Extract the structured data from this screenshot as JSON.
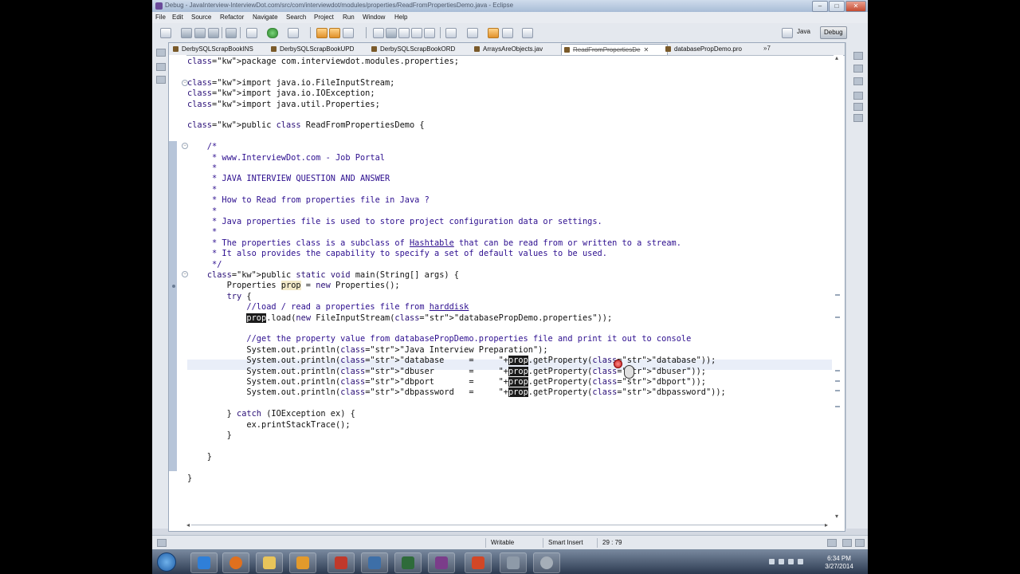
{
  "window": {
    "title": "Debug - JavaInterview-InterviewDot.com/src/com/interviewdot/modules/properties/ReadFromPropertiesDemo.java - Eclipse",
    "controls": {
      "minimize": "–",
      "maximize": "□",
      "close": "✕"
    }
  },
  "menu": [
    "File",
    "Edit",
    "Source",
    "Refactor",
    "Navigate",
    "Search",
    "Project",
    "Run",
    "Window",
    "Help"
  ],
  "perspectives": {
    "java": "Java",
    "debug": "Debug"
  },
  "toolbar_icons": [
    "new-icon",
    "save-icon",
    "save-all-icon",
    "print-icon",
    "debug-icon",
    "run-icon",
    "run-external-icon",
    "new-java-project-icon",
    "new-package-icon",
    "new-class-icon",
    "open-type-icon",
    "search-icon",
    "toggle-mark-icon",
    "next-annotation-icon",
    "prev-annotation-icon",
    "back-icon",
    "forward-icon"
  ],
  "tabs": [
    {
      "label": "DerbySQLScrapBookINS",
      "active": false
    },
    {
      "label": "DerbySQLScrapBookUPD",
      "active": false
    },
    {
      "label": "DerbySQLScrapBookORD",
      "active": false
    },
    {
      "label": "ArraysAreObjects.jav",
      "active": false
    },
    {
      "label": "ReadFromPropertiesDe",
      "active": true
    },
    {
      "label": "databasePropDemo.pro",
      "active": false
    }
  ],
  "tab_overflow": "»7",
  "code_lines": [
    "package com.interviewdot.modules.properties;",
    "",
    "import java.io.FileInputStream;",
    "import java.io.IOException;",
    "import java.util.Properties;",
    "",
    "public class ReadFromPropertiesDemo {",
    "",
    "    /*",
    "     * www.InterviewDot.com - Job Portal",
    "     *",
    "     * JAVA INTERVIEW QUESTION AND ANSWER",
    "     *",
    "     * How to Read from properties file in Java ?",
    "     *",
    "     * Java properties file is used to store project configuration data or settings.",
    "     *",
    "     * The properties class is a subclass of Hashtable that can be read from or written to a stream.",
    "     * It also provides the capability to specify a set of default values to be used.",
    "     */",
    "    public static void main(String[] args) {",
    "        Properties prop = new Properties();",
    "        try {",
    "            //load / read a properties file from harddisk",
    "            prop.load(new FileInputStream(\"databasePropDemo.properties\"));",
    "",
    "            //get the property value from databasePropDemo.properties file and print it out to console",
    "            System.out.println(\"Java Interview Preparation\");",
    "            System.out.println(\"database     =     \"+prop.getProperty(\"database\"));",
    "            System.out.println(\"dbuser       =     \"+prop.getProperty(\"dbuser\"));",
    "            System.out.println(\"dbport       =     \"+prop.getProperty(\"dbport\"));",
    "            System.out.println(\"dbpassword   =     \"+prop.getProperty(\"dbpassword\"));",
    "",
    "        } catch (IOException ex) {",
    "            ex.printStackTrace();",
    "        }",
    "",
    "    }",
    "",
    "}"
  ],
  "status": {
    "writable": "Writable",
    "insert_mode": "Smart Insert",
    "position": "29 : 79"
  },
  "taskbar": {
    "apps": [
      "ie-icon",
      "firefox-icon",
      "explorer-icon",
      "media-player-icon",
      "paint-icon",
      "save-icon",
      "terminal-icon",
      "winrar-icon",
      "powerpoint-icon",
      "printer-icon",
      "settings-icon"
    ],
    "time": "6:34 PM",
    "date": "3/27/2014"
  },
  "colors": {
    "keyword": "#2a0f77",
    "string": "#1e1e9a",
    "comment": "#2d0f8f",
    "selection": "#3a70d0"
  }
}
